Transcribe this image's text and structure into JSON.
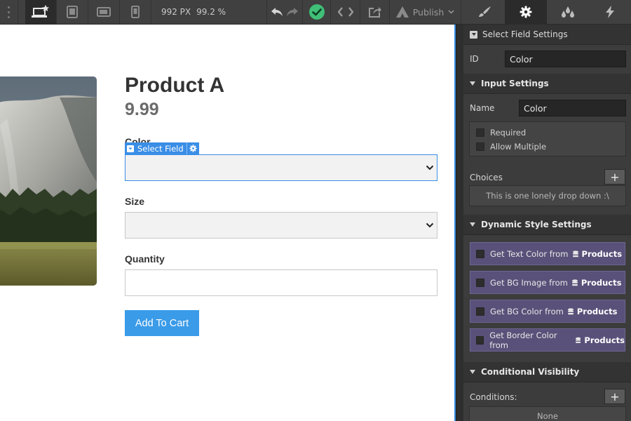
{
  "toolbar": {
    "viewport_width": "992 PX",
    "zoom": "99.2 %",
    "publish_label": "Publish",
    "devices": [
      "desktop-icon",
      "tablet-icon",
      "mobile-landscape-icon",
      "mobile-portrait-icon"
    ],
    "active_device": "desktop-icon",
    "panel_tabs": [
      "brush-icon",
      "gear-icon",
      "drops-icon",
      "bolt-icon"
    ],
    "active_panel_tab": "gear-icon",
    "status_color": "#3fbf77"
  },
  "canvas": {
    "product_title": "Product A",
    "product_price": "9.99",
    "color_label": "Color",
    "select_badge": "Select Field",
    "size_label": "Size",
    "quantity_label": "Quantity",
    "add_to_cart": "Add To Cart",
    "accent": "#3a8ee6"
  },
  "panel": {
    "select_settings": "Select Field Settings",
    "id_label": "ID",
    "id_value": "Color",
    "input_settings": "Input Settings",
    "name_label": "Name",
    "name_value": "Color",
    "required": "Required",
    "allow_multiple": "Allow Multiple",
    "choices_label": "Choices",
    "choices_empty": "This is one lonely drop down :\\",
    "dynamic_style": "Dynamic Style Settings",
    "dynamic_items": [
      {
        "text": "Get Text Color from",
        "source": "Products"
      },
      {
        "text": "Get BG Image from",
        "source": "Products"
      },
      {
        "text": "Get BG Color from",
        "source": "Products"
      },
      {
        "text": "Get Border Color from",
        "source": "Products"
      }
    ],
    "conditional_visibility": "Conditional Visibility",
    "conditions_label": "Conditions:",
    "conditions_value": "None",
    "plus": "+"
  }
}
